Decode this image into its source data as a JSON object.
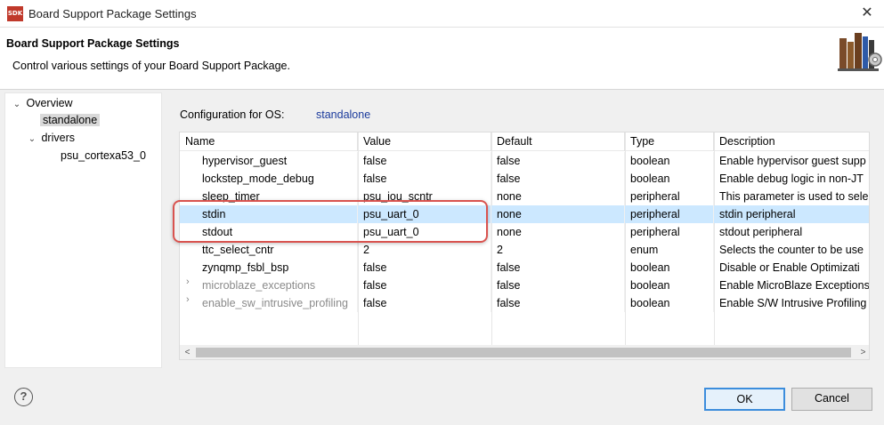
{
  "window": {
    "icon_label": "SDK",
    "title": "Board Support Package Settings",
    "close_symbol": "✕"
  },
  "header": {
    "title": "Board Support Package Settings",
    "description": "Control various settings of your Board Support Package."
  },
  "tree": {
    "overview": "Overview",
    "standalone": "standalone",
    "drivers": "drivers",
    "driver_item": "psu_cortexa53_0"
  },
  "config": {
    "label": "Configuration for OS:",
    "os": "standalone"
  },
  "table": {
    "columns": [
      "Name",
      "Value",
      "Default",
      "Type",
      "Description"
    ],
    "rows": [
      {
        "name": "hypervisor_guest",
        "value": "false",
        "default": "false",
        "type": "boolean",
        "description": "Enable hypervisor guest supp"
      },
      {
        "name": "lockstep_mode_debug",
        "value": "false",
        "default": "false",
        "type": "boolean",
        "description": "Enable debug logic in non-JT"
      },
      {
        "name": "sleep_timer",
        "value": "psu_iou_scntr",
        "default": "none",
        "type": "peripheral",
        "description": "This parameter is used to sele"
      },
      {
        "name": "stdin",
        "value": "psu_uart_0",
        "default": "none",
        "type": "peripheral",
        "description": "stdin peripheral"
      },
      {
        "name": "stdout",
        "value": "psu_uart_0",
        "default": "none",
        "type": "peripheral",
        "description": "stdout peripheral"
      },
      {
        "name": "ttc_select_cntr",
        "value": "2",
        "default": "2",
        "type": "enum",
        "description": "Selects the counter to be use"
      },
      {
        "name": "zynqmp_fsbl_bsp",
        "value": "false",
        "default": "false",
        "type": "boolean",
        "description": "Disable or Enable Optimizati"
      },
      {
        "name": "microblaze_exceptions",
        "value": "false",
        "default": "false",
        "type": "boolean",
        "description": "Enable MicroBlaze Exceptions"
      },
      {
        "name": "enable_sw_intrusive_profiling",
        "value": "false",
        "default": "false",
        "type": "boolean",
        "description": "Enable S/W Intrusive Profiling"
      }
    ],
    "selected_row": "stdin"
  },
  "buttons": {
    "help": "?",
    "ok": "OK",
    "cancel": "Cancel"
  },
  "colors": {
    "selection": "#cce8ff",
    "annotation": "#d9534f",
    "link": "#1a3a9c"
  }
}
